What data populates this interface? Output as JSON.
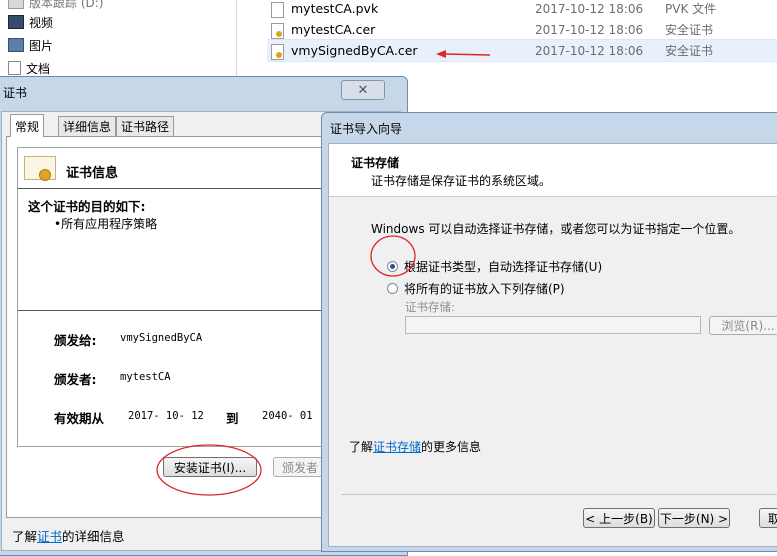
{
  "explorer": {
    "nav_items": [
      {
        "label": "版本跟踪 (D:)",
        "icon": "drive-icon"
      },
      {
        "label": "视频",
        "icon": "video-icon"
      },
      {
        "label": "图片",
        "icon": "picture-icon"
      },
      {
        "label": "文档",
        "icon": "document-icon"
      }
    ],
    "files": [
      {
        "name": "mytestCA.pvk",
        "date": "2017-10-12 18:06",
        "type": "PVK 文件"
      },
      {
        "name": "mytestCA.cer",
        "date": "2017-10-12 18:06",
        "type": "安全证书"
      },
      {
        "name": "vmySignedByCA.cer",
        "date": "2017-10-12 18:06",
        "type": "安全证书"
      }
    ]
  },
  "cert_dialog": {
    "title": "证书",
    "close_symbol": "✕",
    "tabs": [
      "常规",
      "详细信息",
      "证书路径"
    ],
    "info_heading": "证书信息",
    "purpose_label": "这个证书的目的如下:",
    "purpose_item": "•所有应用程序策略",
    "issued_to_label": "颁发给:",
    "issued_to_value": "vmySignedByCA",
    "issued_by_label": "颁发者:",
    "issued_by_value": "mytestCA",
    "valid_label": "有效期从",
    "valid_from": "2017- 10- 12",
    "valid_to_word": "到",
    "valid_to": "2040- 01",
    "install_button": "安装证书(I)...",
    "issuer_button": "颁发者",
    "learn_prefix": "了解",
    "learn_link": "证书",
    "learn_suffix": "的详细信息"
  },
  "wizard": {
    "title": "证书导入向导",
    "header_title": "证书存储",
    "header_desc": "证书存储是保存证书的系统区域。",
    "description": "Windows 可以自动选择证书存储，或者您可以为证书指定一个位置。",
    "option_auto": "根据证书类型，自动选择证书存储(U)",
    "option_manual": "将所有的证书放入下列存储(P)",
    "option_auto_checked": true,
    "store_label": "证书存储:",
    "store_value": "",
    "browse_button": "浏览(R)...",
    "learn_prefix": "了解",
    "learn_link": "证书存储",
    "learn_suffix": "的更多信息",
    "back_button": "< 上一步(B)",
    "next_button": "下一步(N) >",
    "cancel_button": "取"
  },
  "colors": {
    "annotation_red": "#e0262a",
    "link_blue": "#0066cc",
    "window_frame": "#c7d7ea"
  }
}
